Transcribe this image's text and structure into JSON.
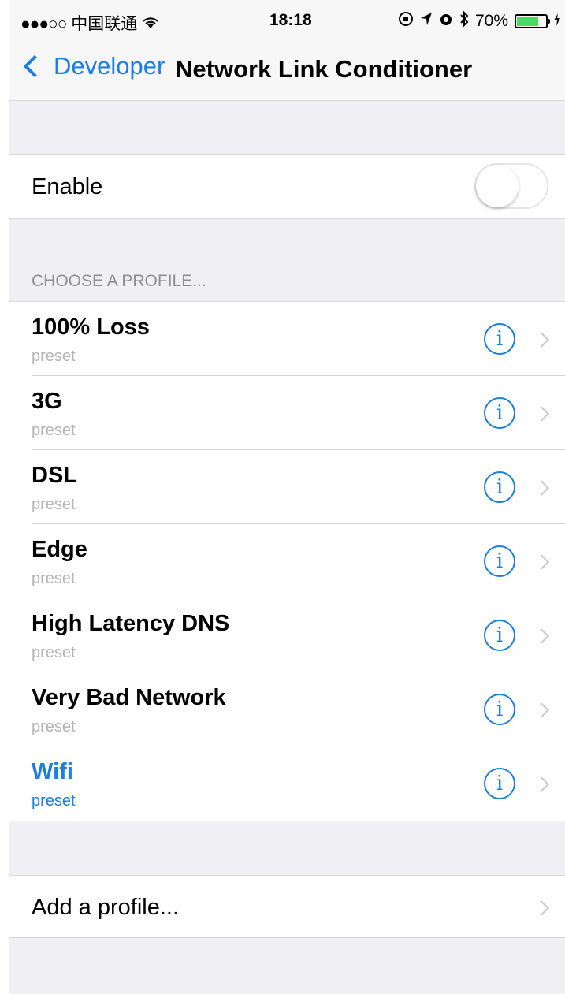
{
  "status_bar": {
    "carrier": "中国联通",
    "signal": "●●●○○",
    "time": "18:18",
    "battery_percent": "70%",
    "battery_level": 0.7,
    "icons": [
      "wifi-icon",
      "lock-rotation-icon",
      "location-icon",
      "alarm-icon",
      "bluetooth-icon",
      "battery-icon",
      "charging-icon"
    ]
  },
  "nav": {
    "back_label": "Developer",
    "title": "Network Link Conditioner"
  },
  "enable": {
    "label": "Enable",
    "on": false
  },
  "section_header": "CHOOSE A PROFILE...",
  "profiles": [
    {
      "name": "100% Loss",
      "sub": "preset",
      "selected": false
    },
    {
      "name": "3G",
      "sub": "preset",
      "selected": false
    },
    {
      "name": "DSL",
      "sub": "preset",
      "selected": false
    },
    {
      "name": "Edge",
      "sub": "preset",
      "selected": false
    },
    {
      "name": "High Latency DNS",
      "sub": "preset",
      "selected": false
    },
    {
      "name": "Very Bad Network",
      "sub": "preset",
      "selected": false
    },
    {
      "name": "Wifi",
      "sub": "preset",
      "selected": true
    }
  ],
  "add_profile_label": "Add a profile...",
  "colors": {
    "accent": "#1b7ee6",
    "background": "#efeff4",
    "secondary_text": "#b4b4b8"
  }
}
